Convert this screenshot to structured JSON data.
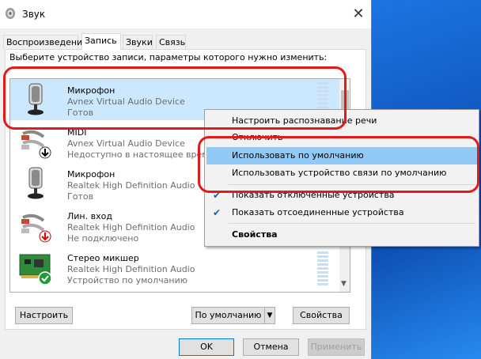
{
  "window": {
    "title": "Звук",
    "close_symbol": "✕"
  },
  "tabs": [
    {
      "label": "Воспроизведение",
      "active": false
    },
    {
      "label": "Запись",
      "active": true
    },
    {
      "label": "Звуки",
      "active": false
    },
    {
      "label": "Связь",
      "active": false
    }
  ],
  "instruction": "Выберите устройство записи, параметры которого нужно изменить:",
  "devices": [
    {
      "name": "Микрофон",
      "line2": "Avnex Virtual Audio Device",
      "line3": "Готов",
      "selected": true,
      "icon": "microphone-icon"
    },
    {
      "name": "MIDI",
      "line2": "Avnex Virtual Audio Device",
      "line3": "Недоступно в настоящее время",
      "icon": "line-in-icon",
      "badge": "down-arrow-badge"
    },
    {
      "name": "Микрофон",
      "line2": "Realtek High Definition Audio",
      "line3": "Готов",
      "icon": "microphone-icon"
    },
    {
      "name": "Лин. вход",
      "line2": "Realtek High Definition Audio",
      "line3": "Не подключено",
      "icon": "line-in-icon",
      "badge": "red-down-arrow-badge"
    },
    {
      "name": "Стерео микшер",
      "line2": "Realtek High Definition Audio",
      "line3": "Устройство по умолчанию",
      "icon": "sound-card-icon",
      "badge": "green-check-badge"
    }
  ],
  "buttons": {
    "configure": "Настроить",
    "set_default": "По умолчанию",
    "properties": "Свойства",
    "ok": "OK",
    "cancel": "Отмена",
    "apply": "Применить"
  },
  "context_menu": {
    "items": [
      {
        "label": "Настроить распознавание речи"
      },
      {
        "label": "Отключить"
      },
      {
        "label": "Использовать по умолчанию",
        "highlighted": true
      },
      {
        "label": "Использовать устройство связи по умолчанию"
      },
      {
        "label": "Показать отключенные устройства",
        "checked": true
      },
      {
        "label": "Показать отсоединенные устройства",
        "checked": true
      },
      {
        "label": "Свойства",
        "bold": true
      }
    ],
    "check_symbol": "✔"
  },
  "colors": {
    "selection": "#cce8ff",
    "menu_highlight": "#91c9f7",
    "annotation": "#e21a1a",
    "accent": "#0078d7"
  }
}
